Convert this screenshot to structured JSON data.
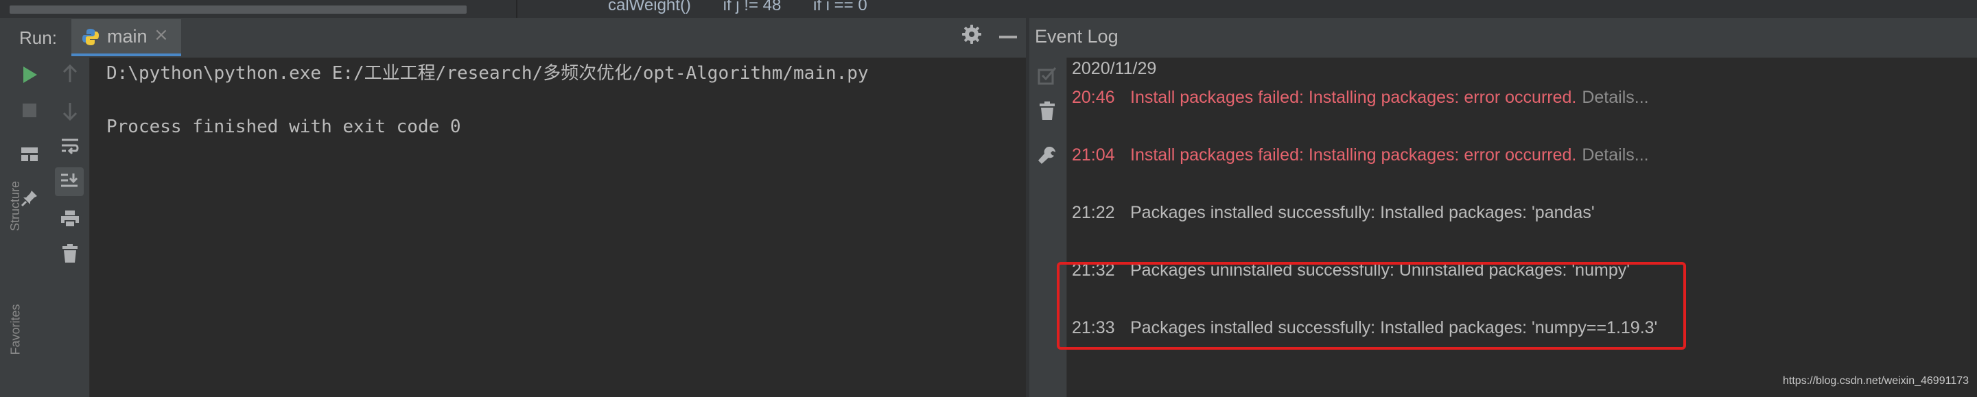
{
  "breadcrumbs": [
    "calWeight()",
    "if j != 48",
    "if i == 0"
  ],
  "run_panel": {
    "label": "Run:",
    "tab_label": "main",
    "tab_close": "×",
    "console_lines": [
      "D:\\python\\python.exe E:/工业工程/research/多频次优化/opt-Algorithm/main.py",
      "",
      "Process finished with exit code 0"
    ]
  },
  "side_labels": [
    "Structure",
    "Favorites"
  ],
  "event_log": {
    "title": "Event Log",
    "date": "2020/11/29",
    "entries": [
      {
        "time": "20:46",
        "message": "Install packages failed: Installing packages: error occurred.",
        "link": "Details...",
        "status": "error"
      },
      {
        "time": "21:04",
        "message": "Install packages failed: Installing packages: error occurred.",
        "link": "Details...",
        "status": "error"
      },
      {
        "time": "21:22",
        "message": "Packages installed successfully: Installed packages: 'pandas'",
        "status": "ok"
      },
      {
        "time": "21:32",
        "message": "Packages uninstalled successfully: Uninstalled packages: 'numpy'",
        "status": "ok"
      },
      {
        "time": "21:33",
        "message": "Packages installed successfully: Installed packages: 'numpy==1.19.3'",
        "status": "ok"
      }
    ]
  },
  "watermark": "https://blog.csdn.net/weixin_46991173",
  "colors": {
    "error": "#e5646e",
    "run_green": "#59a869",
    "highlight_box": "#e01f1f",
    "tab_underline": "#4a88c7"
  },
  "icons": [
    "run-icon",
    "stop-icon",
    "layout-icon",
    "pin-icon",
    "up-arrow-icon",
    "down-arrow-icon",
    "soft-wrap-icon",
    "scroll-to-end-icon",
    "print-icon",
    "trash-icon",
    "gear-icon",
    "minimize-icon",
    "python-icon",
    "mark-read-icon",
    "wrench-icon"
  ]
}
